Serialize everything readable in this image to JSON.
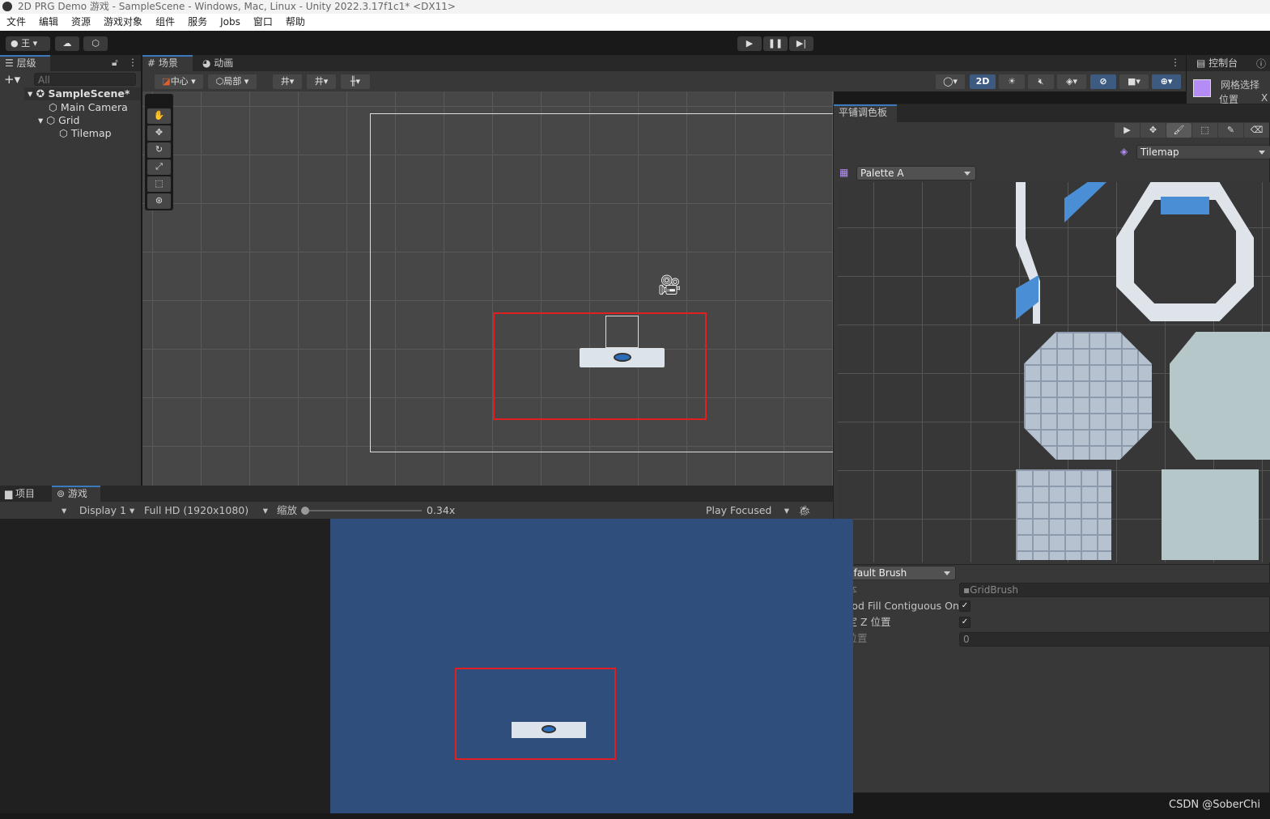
{
  "window": {
    "title": "2D PRG Demo 游戏 - SampleScene - Windows, Mac, Linux - Unity 2022.3.17f1c1* <DX11>"
  },
  "menu": [
    "文件",
    "编辑",
    "资源",
    "游戏对象",
    "组件",
    "服务",
    "Jobs",
    "窗口",
    "帮助"
  ],
  "toolbar": {
    "account": "王",
    "play_icon": "play-icon",
    "pause_icon": "pause-icon",
    "step_icon": "step-icon"
  },
  "hierarchy": {
    "tab": "层级",
    "search_placeholder": "All",
    "items": [
      {
        "label": "SampleScene*"
      },
      {
        "label": "Main Camera"
      },
      {
        "label": "Grid"
      },
      {
        "label": "Tilemap"
      }
    ]
  },
  "scene": {
    "tabs": [
      "场景",
      "动画"
    ],
    "pivot": "中心",
    "space": "局部",
    "mode_2d": "2D"
  },
  "inspector": {
    "tabs": [
      "控制台"
    ],
    "title": "网格选择",
    "position_label": "位置",
    "x_label": "X"
  },
  "palette": {
    "tab": "平铺调色板",
    "target": "Tilemap",
    "palette": "Palette A",
    "brush": "Default Brush",
    "props": [
      {
        "label": "脚本",
        "value": "GridBrush"
      },
      {
        "label": "Flood Fill Contiguous Only",
        "checked": true
      },
      {
        "label": "锁定 Z 位置",
        "checked": true
      },
      {
        "label": "Z 位置",
        "value": "0"
      }
    ]
  },
  "game": {
    "tabs": [
      "项目",
      "游戏"
    ],
    "display": "Display 1",
    "resolution": "Full HD (1920x1080)",
    "scale_label": "缩放",
    "scale": "0.34x",
    "scale_value": 0.34,
    "play_mode": "Play Focused"
  },
  "colors": {
    "accent": "#3a79bb",
    "selection_box": "#e02020",
    "game_bg": "#2f4e7c"
  },
  "watermark": "CSDN @SoberChi"
}
